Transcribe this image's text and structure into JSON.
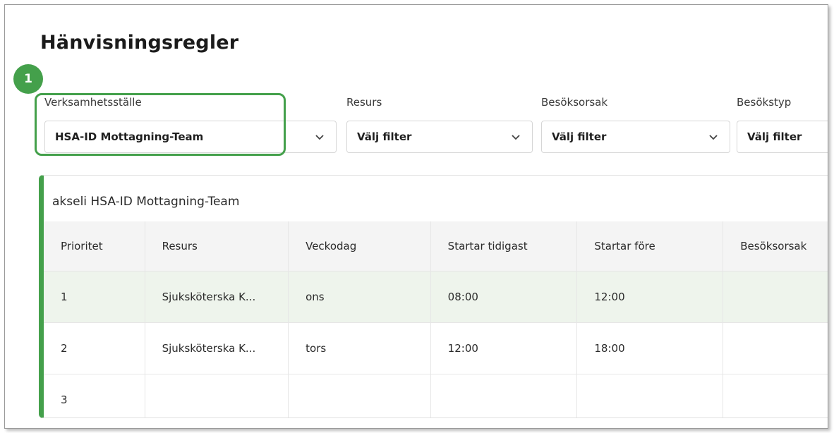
{
  "page": {
    "title": "Hänvisningsregler",
    "step_badge": "1"
  },
  "filters": [
    {
      "label": "Verksamhetsställe",
      "value": "HSA-ID Mottagning-Team"
    },
    {
      "label": "Resurs",
      "value": "Välj filter"
    },
    {
      "label": "Besöksorsak",
      "value": "Välj filter"
    },
    {
      "label": "Besökstyp",
      "value": "Välj filter"
    }
  ],
  "table_card": {
    "title": "akseli HSA-ID Mottagning-Team",
    "columns": [
      "Prioritet",
      "Resurs",
      "Veckodag",
      "Startar tidigast",
      "Startar före",
      "Besöksorsak"
    ],
    "rows": [
      [
        "1",
        "Sjuksköterska K...",
        "ons",
        "08:00",
        "12:00",
        ""
      ],
      [
        "2",
        "Sjuksköterska K...",
        "tors",
        "12:00",
        "18:00",
        ""
      ],
      [
        "3",
        "",
        "",
        "",
        "",
        ""
      ]
    ]
  },
  "colors": {
    "accent_green": "#44a04b",
    "selected_row_bg": "#eef4ec",
    "header_bg": "#f4f4f4"
  },
  "icons": {
    "dropdown": "chevron-down-icon"
  }
}
